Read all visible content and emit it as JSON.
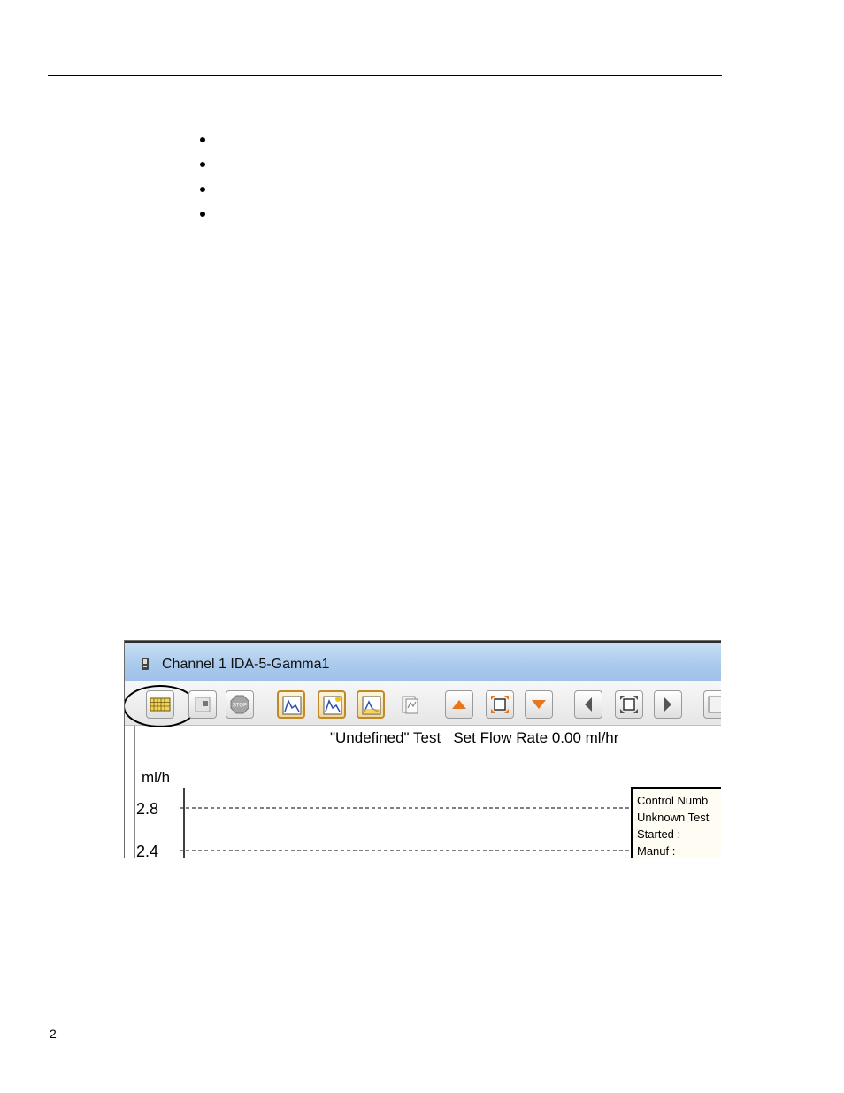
{
  "page": {
    "page_number": "2"
  },
  "bullets": [
    "",
    "",
    "",
    ""
  ],
  "screenshot": {
    "window_title": "Channel 1 IDA-5-Gamma1",
    "toolbar_icons": [
      "keyboard-icon",
      "record-icon",
      "stop-icon",
      "graph-icon",
      "graph-new-icon",
      "graph-recent-icon",
      "report-icon",
      "arrow-up-icon",
      "zoom-fit-vertical-icon",
      "arrow-down-icon",
      "arrow-left-icon",
      "zoom-fit-horizontal-icon",
      "arrow-right-icon",
      "export-icon"
    ],
    "stop_label": "STOP",
    "chart_header": "\"Undefined\" Test   Set Flow Rate 0.00 ml/hr",
    "info_box": [
      "Control Numb",
      "Unknown Test",
      "Started :",
      "Manuf :"
    ],
    "colors": {
      "titlebar": "#a9c9ec",
      "highlight_button": "#f0d79b",
      "orange_arrow": "#e8761d"
    }
  },
  "chart_data": {
    "type": "line",
    "ylabel": "ml/h",
    "y_ticks": [
      2.8,
      2.4
    ],
    "tick_labels": [
      "2.8",
      "2.4"
    ],
    "grid": true,
    "series": []
  }
}
